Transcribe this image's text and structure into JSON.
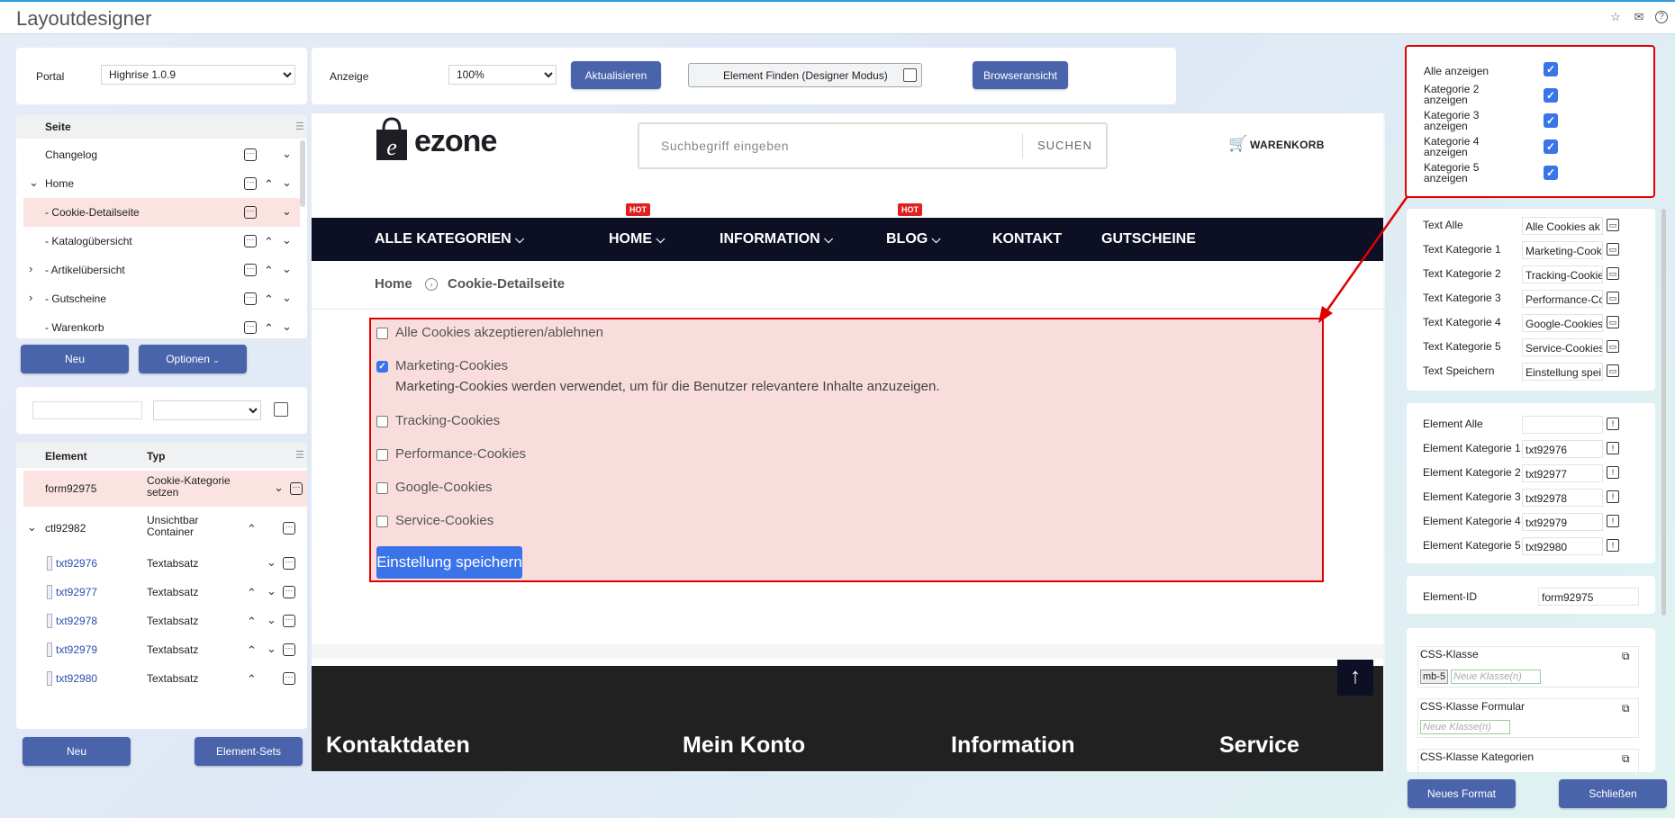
{
  "app": {
    "title": "Layoutdesigner",
    "icons": [
      "star-icon",
      "mail-icon",
      "help-icon"
    ]
  },
  "toolbar": {
    "portal_label": "Portal",
    "portal_value": "Highrise 1.0.9",
    "anzeige_label": "Anzeige",
    "zoom_value": "100%",
    "aktualisieren": "Aktualisieren",
    "element_finden": "Element Finden (Designer Modus)",
    "browseransicht": "Browseransicht"
  },
  "pages": {
    "header": "Seite",
    "items": [
      {
        "label": "Changelog"
      },
      {
        "label": "Home"
      },
      {
        "label": "- Cookie-Detailseite"
      },
      {
        "label": "- Katalogübersicht"
      },
      {
        "label": "- Artikelübersicht"
      },
      {
        "label": "- Gutscheine"
      },
      {
        "label": "- Warenkorb"
      }
    ],
    "neu": "Neu",
    "optionen": "Optionen"
  },
  "elements": {
    "col_element": "Element",
    "col_typ": "Typ",
    "rows": [
      {
        "name": "form92975",
        "type": "Cookie-Kategorie setzen"
      },
      {
        "name": "ctl92982",
        "type": "Unsichtbar Container"
      },
      {
        "name": "txt92976",
        "type": "Textabsatz"
      },
      {
        "name": "txt92977",
        "type": "Textabsatz"
      },
      {
        "name": "txt92978",
        "type": "Textabsatz"
      },
      {
        "name": "txt92979",
        "type": "Textabsatz"
      },
      {
        "name": "txt92980",
        "type": "Textabsatz"
      }
    ],
    "neu": "Neu",
    "element_sets": "Element-Sets"
  },
  "preview": {
    "logo": "ezone",
    "search_placeholder": "Suchbegriff eingeben",
    "search_button": "SUCHEN",
    "cart": "WARENKORB",
    "nav": [
      "ALLE KATEGORIEN",
      "HOME",
      "INFORMATION",
      "BLOG",
      "KONTAKT",
      "GUTSCHEINE"
    ],
    "hot": "HOT",
    "breadcrumb": {
      "home": "Home",
      "current": "Cookie-Detailseite"
    },
    "cookies": {
      "all": "Alle Cookies akzeptieren/ablehnen",
      "marketing": "Marketing-Cookies",
      "marketing_desc": "Marketing-Cookies werden verwendet, um für die Benutzer relevantere Inhalte anzuzeigen.",
      "tracking": "Tracking-Cookies",
      "performance": "Performance-Cookies",
      "google": "Google-Cookies",
      "service": "Service-Cookies",
      "save": "Einstellung speichern"
    },
    "footer": [
      "Kontaktdaten",
      "Mein Konto",
      "Information",
      "Service"
    ]
  },
  "right": {
    "show": [
      {
        "label": "Alle anzeigen",
        "checked": true
      },
      {
        "label": "Kategorie 2 anzeigen",
        "checked": true
      },
      {
        "label": "Kategorie 3 anzeigen",
        "checked": true
      },
      {
        "label": "Kategorie 4 anzeigen",
        "checked": true
      },
      {
        "label": "Kategorie 5 anzeigen",
        "checked": true
      }
    ],
    "texts": [
      {
        "label": "Text Alle",
        "value": "Alle Cookies ak"
      },
      {
        "label": "Text Kategorie 1",
        "value": "Marketing-Cook"
      },
      {
        "label": "Text Kategorie 2",
        "value": "Tracking-Cookie"
      },
      {
        "label": "Text Kategorie 3",
        "value": "Performance-Co"
      },
      {
        "label": "Text Kategorie 4",
        "value": "Google-Cookies"
      },
      {
        "label": "Text Kategorie 5",
        "value": "Service-Cookies"
      },
      {
        "label": "Text Speichern",
        "value": "Einstellung spei"
      }
    ],
    "elements": [
      {
        "label": "Element Alle",
        "value": ""
      },
      {
        "label": "Element Kategorie 1",
        "value": "txt92976"
      },
      {
        "label": "Element Kategorie 2",
        "value": "txt92977"
      },
      {
        "label": "Element Kategorie 3",
        "value": "txt92978"
      },
      {
        "label": "Element Kategorie 4",
        "value": "txt92979"
      },
      {
        "label": "Element Kategorie 5",
        "value": "txt92980"
      }
    ],
    "element_id_label": "Element-ID",
    "element_id_value": "form92975",
    "css_klasse": "CSS-Klasse",
    "css_tag": "mb-5",
    "neue_klasse": "Neue Klasse(n)",
    "css_formular": "CSS-Klasse Formular",
    "css_kategorien": "CSS-Klasse Kategorien",
    "neues_format": "Neues Format",
    "schliessen": "Schließen"
  },
  "colors": {
    "accent": "#4a64ac",
    "highlight": "#e00000",
    "selected_row": "#fae3e1",
    "nav_bg": "#0d0f24"
  }
}
